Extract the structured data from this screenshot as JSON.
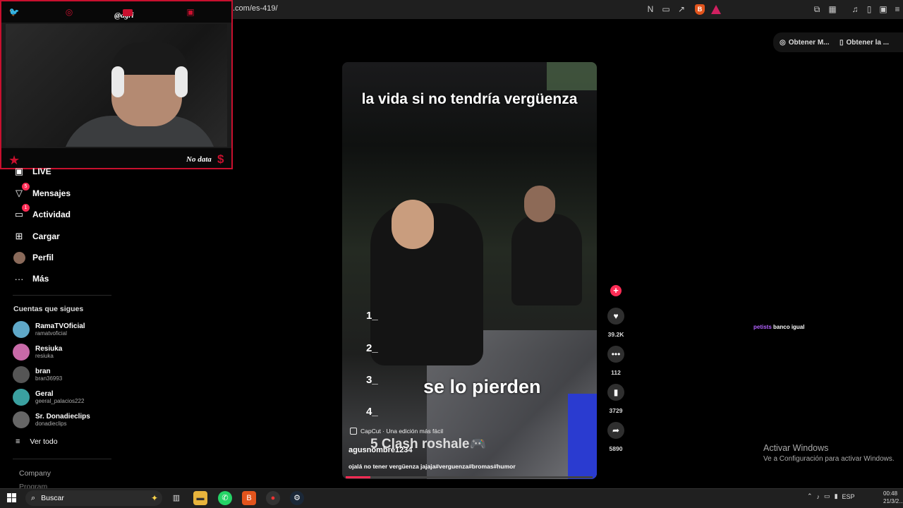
{
  "browser": {
    "url": ".com/es-419/",
    "icons": [
      "no-translate-icon",
      "screen-cast-icon",
      "share-icon",
      "brave-shield-icon",
      "rewards-icon",
      "extensions-icon",
      "sidebar-icon",
      "media-icon",
      "reader-icon",
      "wallet-icon"
    ]
  },
  "webcam": {
    "handle": "@agri",
    "footer_text": "No data",
    "dollar": "$"
  },
  "nav": {
    "items": [
      {
        "label": "LIVE",
        "icon": "live-icon",
        "badge": ""
      },
      {
        "label": "Mensajes",
        "icon": "inbox-icon",
        "badge": "5"
      },
      {
        "label": "Actividad",
        "icon": "activity-icon",
        "badge": "1"
      },
      {
        "label": "Cargar",
        "icon": "upload-icon",
        "badge": ""
      },
      {
        "label": "Perfil",
        "icon": "profile-icon",
        "badge": ""
      },
      {
        "label": "Más",
        "icon": "more-icon",
        "badge": ""
      }
    ],
    "following_title": "Cuentas que sigues",
    "accounts": [
      {
        "name": "RamaTVOficial",
        "user": "ramatvoficial",
        "color": "#5fa8c8"
      },
      {
        "name": "Resiuka",
        "user": "resiuka",
        "color": "#c86aa8"
      },
      {
        "name": "bran",
        "user": "bran36993",
        "color": "#555555"
      },
      {
        "name": "Geral",
        "user": "geeral_palacios222",
        "color": "#3aa0a0"
      },
      {
        "name": "Sr. Donadieclips",
        "user": "donadieclips",
        "color": "#666666"
      }
    ],
    "see_all": "Ver todo",
    "company": "Company",
    "program": "Program"
  },
  "video": {
    "caption_top": "la vida si no tendría vergüenza",
    "caption_mid": "se lo pierden",
    "list": [
      "1_",
      "2_",
      "3_",
      "4_"
    ],
    "capcut": "CapCut · Una edición más fácil",
    "clash": "5 Clash roshale🎮",
    "author": "agusnombre1234",
    "description": "ojalá no tener vergüenza jajaja#verguenza#bromas#humor",
    "progress": 0.1
  },
  "actions": {
    "likes": "39.2K",
    "comments": "112",
    "saves": "3729",
    "shares": "5890"
  },
  "extension_buttons": [
    "Obtener M...",
    "Obtener la ..."
  ],
  "chat": {
    "user": "petists",
    "message": "banco igual"
  },
  "activation": {
    "title": "Activar Windows",
    "subtitle": "Ve a Configuración para activar Windows."
  },
  "taskbar": {
    "search_placeholder": "Buscar",
    "lang": "ESP",
    "time": "00:48",
    "date": "21/3/2..."
  },
  "colors": {
    "accent": "#fe2c55",
    "cam_border": "#c8102e"
  }
}
